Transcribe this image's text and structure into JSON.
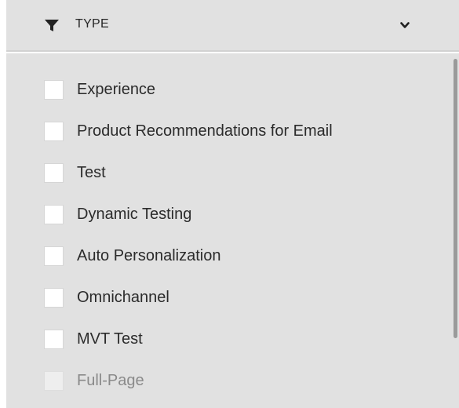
{
  "filter": {
    "title": "TYPE",
    "icon": "funnel-icon",
    "toggle_icon": "chevron-down-icon",
    "options": [
      {
        "label": "Experience",
        "checked": false,
        "disabled": false
      },
      {
        "label": "Product Recommendations for Email",
        "checked": false,
        "disabled": false
      },
      {
        "label": "Test",
        "checked": false,
        "disabled": false
      },
      {
        "label": "Dynamic Testing",
        "checked": false,
        "disabled": false
      },
      {
        "label": "Auto Personalization",
        "checked": false,
        "disabled": false
      },
      {
        "label": "Omnichannel",
        "checked": false,
        "disabled": false
      },
      {
        "label": "MVT Test",
        "checked": false,
        "disabled": false
      },
      {
        "label": "Full-Page",
        "checked": false,
        "disabled": true
      }
    ]
  },
  "colors": {
    "panel_background": "#e1e1e1",
    "checkbox": "#ffffff",
    "text": "#2b2b2b",
    "disabled_text": "#8a8a8a",
    "scrollbar_thumb": "#9a9a9a"
  }
}
